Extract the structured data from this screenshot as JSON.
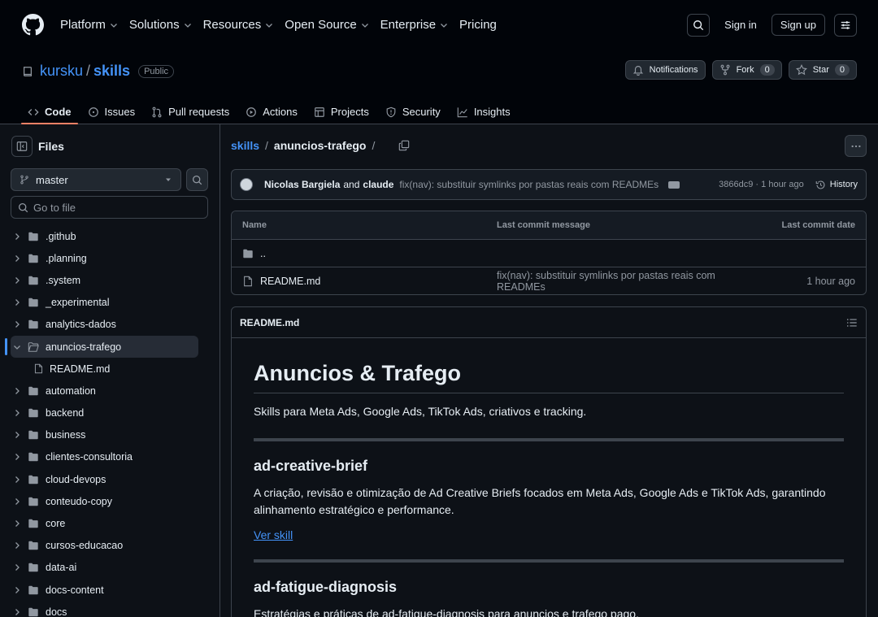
{
  "header": {
    "nav": [
      {
        "label": "Platform",
        "dropdown": true
      },
      {
        "label": "Solutions",
        "dropdown": true
      },
      {
        "label": "Resources",
        "dropdown": true
      },
      {
        "label": "Open Source",
        "dropdown": true
      },
      {
        "label": "Enterprise",
        "dropdown": true
      },
      {
        "label": "Pricing",
        "dropdown": false
      }
    ],
    "sign_in": "Sign in",
    "sign_up": "Sign up"
  },
  "repo": {
    "owner": "kursku",
    "separator": "/",
    "name": "skills",
    "visibility": "Public",
    "notifications_label": "Notifications",
    "fork_label": "Fork",
    "fork_count": "0",
    "star_label": "Star",
    "star_count": "0",
    "tabs": [
      {
        "label": "Code",
        "icon": "code-icon",
        "active": true
      },
      {
        "label": "Issues",
        "icon": "issue-icon",
        "active": false
      },
      {
        "label": "Pull requests",
        "icon": "pull-request-icon",
        "active": false
      },
      {
        "label": "Actions",
        "icon": "play-icon",
        "active": false
      },
      {
        "label": "Projects",
        "icon": "table-icon",
        "active": false
      },
      {
        "label": "Security",
        "icon": "shield-icon",
        "active": false
      },
      {
        "label": "Insights",
        "icon": "graph-icon",
        "active": false
      }
    ]
  },
  "sidebar": {
    "title": "Files",
    "branch": "master",
    "goto_placeholder": "Go to file",
    "tree": [
      {
        "label": ".github"
      },
      {
        "label": ".planning"
      },
      {
        "label": ".system"
      },
      {
        "label": "_experimental"
      },
      {
        "label": "analytics-dados"
      },
      {
        "label": "anuncios-trafego",
        "selected": true
      },
      {
        "label": "README.md",
        "child": true
      },
      {
        "label": "automation"
      },
      {
        "label": "backend"
      },
      {
        "label": "business"
      },
      {
        "label": "clientes-consultoria"
      },
      {
        "label": "cloud-devops"
      },
      {
        "label": "conteudo-copy"
      },
      {
        "label": "core"
      },
      {
        "label": "cursos-educacao"
      },
      {
        "label": "data-ai"
      },
      {
        "label": "docs-content"
      },
      {
        "label": "docs"
      }
    ]
  },
  "main": {
    "breadcrumb_root": "skills",
    "breadcrumb_current": "anuncios-trafego",
    "breadcrumb_sep": "/",
    "commit": {
      "author1": "Nicolas Bargiela",
      "and": "and",
      "author2": "claude",
      "message": "fix(nav): substituir symlinks por pastas reais com READMEs",
      "sha_time": "3866dc9 · 1 hour ago",
      "history": "History"
    },
    "table": {
      "headers": [
        "Name",
        "Last commit message",
        "Last commit date"
      ],
      "parent": "..",
      "rows": [
        {
          "name": "README.md",
          "message": "fix(nav): substituir symlinks por pastas reais com READMEs",
          "date": "1 hour ago"
        }
      ]
    },
    "readme": {
      "filename": "README.md",
      "h1": "Anuncios & Trafego",
      "intro": "Skills para Meta Ads, Google Ads, TikTok Ads, criativos e tracking.",
      "s1_title": "ad-creative-brief",
      "s1_text": "A criação, revisão e otimização de Ad Creative Briefs focados em Meta Ads, Google Ads e TikTok Ads, garantindo alinhamento estratégico e performance.",
      "s1_link": "Ver skill",
      "s2_title": "ad-fatigue-diagnosis",
      "s2_text": "Estratégias e práticas de ad-fatigue-diagnosis para anuncios e trafego pago."
    }
  }
}
